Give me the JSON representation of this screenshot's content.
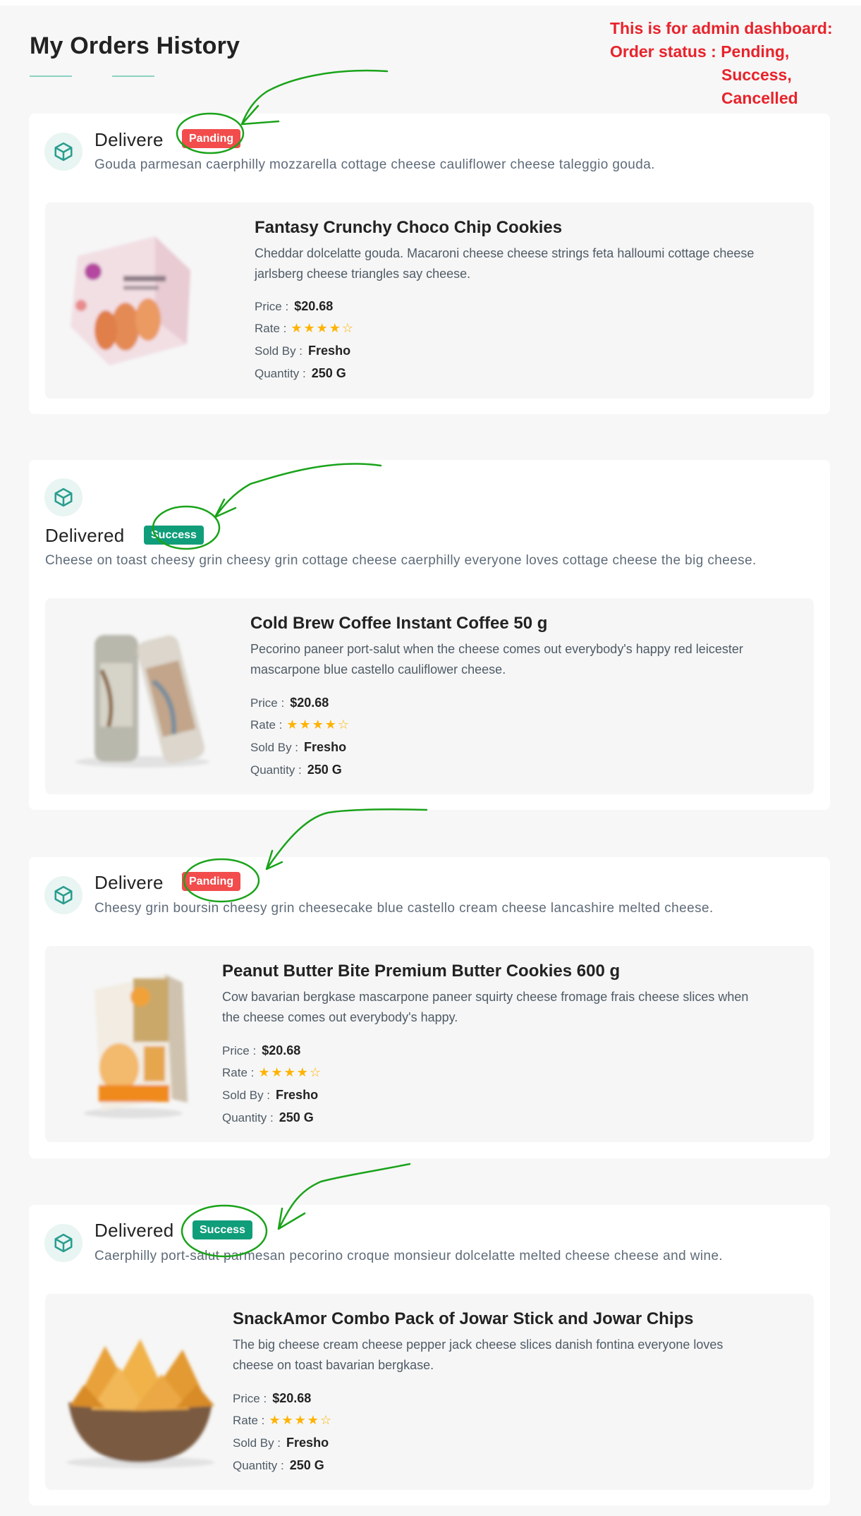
{
  "page": {
    "title": "My Orders History"
  },
  "note": {
    "lines": [
      "This is for admin dashboard:",
      "Order status : Pending,",
      "Success,",
      "Cancelled"
    ]
  },
  "icons": {
    "order": "package-box-icon",
    "rating": "star-icon"
  },
  "colors": {
    "pending": "#f24c4c",
    "success": "#109d7a",
    "accent": "#3bb77e",
    "star": "#ffb300",
    "annotation": "#1aa31a",
    "note": "#e8232b"
  },
  "labels": {
    "price": "Price :",
    "rate": "Rate :",
    "sold_by": "Sold By :",
    "quantity": "Quantity :"
  },
  "orders": [
    {
      "title": "Delivere",
      "status": "Panding",
      "description": "Gouda parmesan caerphilly mozzarella cottage cheese cauliflower cheese taleggio gouda.",
      "product": {
        "name": "Fantasy Crunchy Choco Chip Cookies",
        "description_lines": [
          "Cheddar dolcelatte gouda. Macaroni cheese cheese strings feta halloumi cottage cheese",
          "jarlsberg cheese triangles say cheese."
        ],
        "price": "$20.68",
        "rating": 4,
        "rating_max": 5,
        "sold_by": "Fresho",
        "quantity": "250 G"
      }
    },
    {
      "title": "Delivered",
      "status": "Success",
      "description": "Cheese on toast cheesy grin cheesy grin cottage cheese caerphilly everyone loves cottage cheese the big cheese.",
      "product": {
        "name": "Cold Brew Coffee Instant Coffee 50 g",
        "description_lines": [
          "Pecorino paneer port-salut when the cheese comes out everybody's happy red leicester",
          "mascarpone blue castello cauliflower cheese."
        ],
        "price": "$20.68",
        "rating": 4,
        "rating_max": 5,
        "sold_by": "Fresho",
        "quantity": "250 G"
      }
    },
    {
      "title": "Delivere",
      "status": "Panding",
      "description": "Cheesy grin boursin cheesy grin cheesecake blue castello cream cheese lancashire melted cheese.",
      "product": {
        "name": "Peanut Butter Bite Premium Butter Cookies 600 g",
        "description_lines": [
          "Cow bavarian bergkase mascarpone paneer squirty cheese fromage frais cheese slices when",
          "the cheese comes out everybody's happy."
        ],
        "price": "$20.68",
        "rating": 4,
        "rating_max": 5,
        "sold_by": "Fresho",
        "quantity": "250 G"
      }
    },
    {
      "title": "Delivered",
      "status": "Success",
      "description": "Caerphilly port-salut parmesan pecorino croque monsieur dolcelatte melted cheese cheese and wine.",
      "product": {
        "name": "SnackAmor Combo Pack of Jowar Stick and Jowar Chips",
        "description_lines": [
          "The big cheese cream cheese pepper jack cheese slices danish fontina everyone loves",
          "cheese on toast bavarian bergkase."
        ],
        "price": "$20.68",
        "rating": 4,
        "rating_max": 5,
        "sold_by": "Fresho",
        "quantity": "250 G"
      }
    }
  ]
}
